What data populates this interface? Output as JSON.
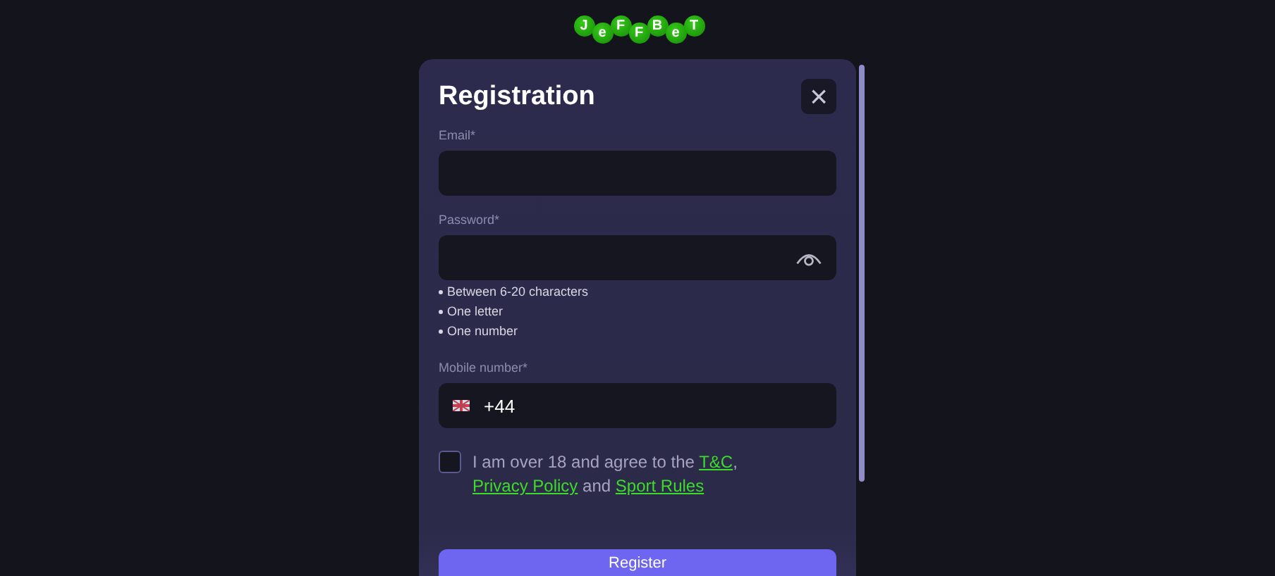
{
  "logo": {
    "letters": [
      "J",
      "e",
      "F",
      "F",
      "B",
      "e",
      "T"
    ]
  },
  "dialog": {
    "title": "Registration",
    "close_label": "×"
  },
  "fields": [
    {
      "kind": "email",
      "label": "Email*"
    },
    {
      "kind": "password",
      "label": "Password*",
      "rules": [
        "Between 6-20 characters",
        "One letter",
        "One number"
      ]
    },
    {
      "kind": "phone",
      "label": "Mobile number*",
      "value": "+44"
    }
  ],
  "consent": {
    "checked": false,
    "parts": [
      {
        "kind": "text",
        "text": "I am over 18 and agree to the "
      },
      {
        "kind": "link",
        "text": "T&C"
      },
      {
        "kind": "text",
        "text": ", "
      },
      {
        "kind": "link",
        "text": "Privacy Policy"
      },
      {
        "kind": "text",
        "text": " and "
      },
      {
        "kind": "link",
        "text": "Sport Rules"
      }
    ]
  },
  "submit": {
    "label": "Register"
  }
}
